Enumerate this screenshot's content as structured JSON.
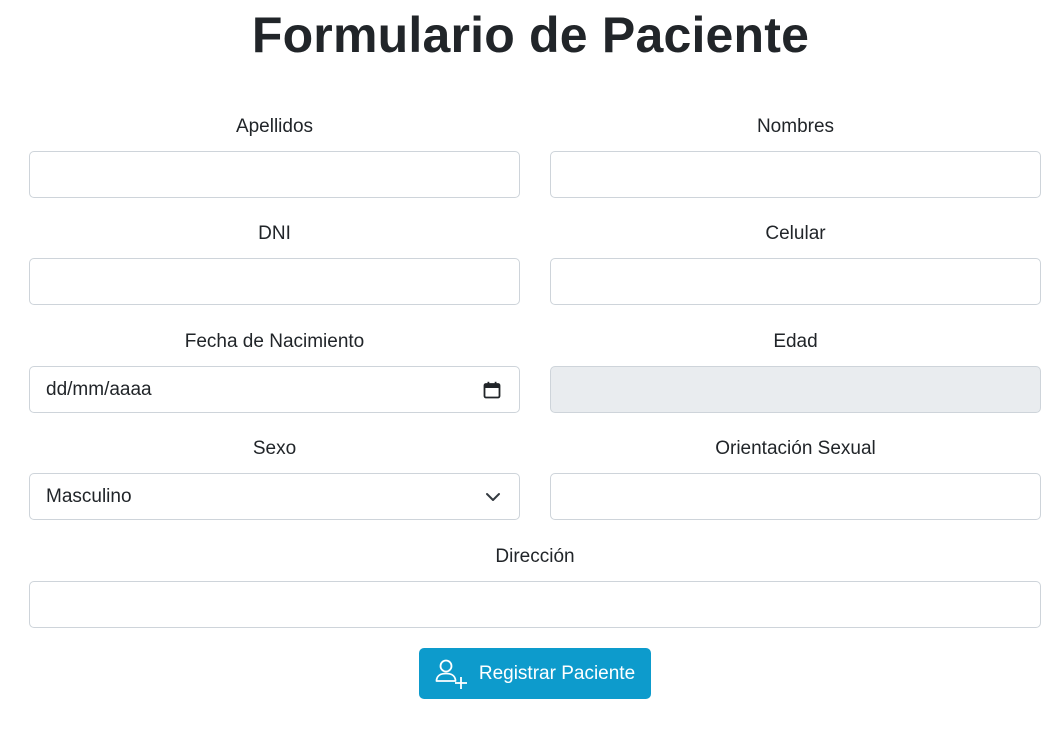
{
  "form": {
    "title": "Formulario de Paciente",
    "fields": {
      "apellidos": {
        "label": "Apellidos",
        "value": ""
      },
      "nombres": {
        "label": "Nombres",
        "value": ""
      },
      "dni": {
        "label": "DNI",
        "value": ""
      },
      "celular": {
        "label": "Celular",
        "value": ""
      },
      "fecha_nacimiento": {
        "label": "Fecha de Nacimiento",
        "placeholder": "dd/mm/aaaa",
        "icon": "calendar-icon"
      },
      "edad": {
        "label": "Edad",
        "value": ""
      },
      "sexo": {
        "label": "Sexo",
        "selected": "Masculino",
        "icon": "chevron-down-icon"
      },
      "orientacion": {
        "label": "Orientación Sexual",
        "value": ""
      },
      "direccion": {
        "label": "Dirección",
        "value": ""
      }
    },
    "submit": {
      "label": "Registrar Paciente",
      "icon": "user-plus-icon"
    }
  },
  "colors": {
    "button": "#0d9bcc",
    "border": "#ced4da",
    "disabled_bg": "#e9ecef",
    "text": "#212529"
  }
}
